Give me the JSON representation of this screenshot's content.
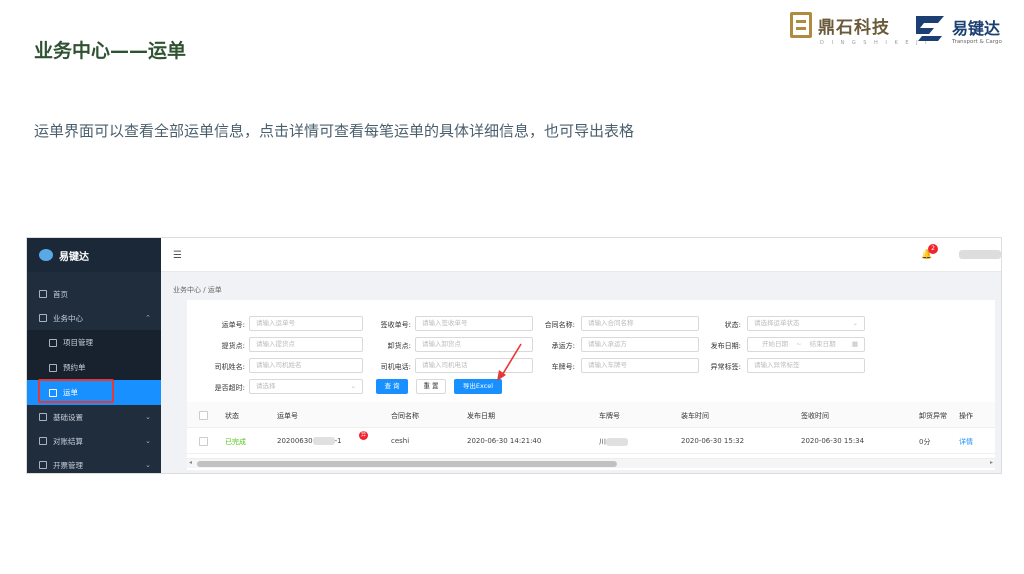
{
  "slide": {
    "title": "业务中心——运单",
    "description": "运单界面可以查看全部运单信息，点击详情可查看每笔运单的具体详细信息，也可导出表格",
    "logo1": {
      "name": "鼎石科技",
      "sub": "D I N G S H I K E J I",
      "color": "#b08a3e"
    },
    "logo2": {
      "name": "易键达",
      "sub": "Transport & Cargo",
      "color": "#1c3f73"
    }
  },
  "app": {
    "brand": "易键达",
    "sidebar": {
      "items": [
        {
          "label": "首页",
          "icon": "home-icon"
        },
        {
          "label": "业务中心",
          "icon": "briefcase-icon",
          "chevron": "⌃"
        },
        {
          "label": "项目管理",
          "icon": "calendar-icon"
        },
        {
          "label": "预约单",
          "icon": "calendar-icon"
        },
        {
          "label": "运单",
          "icon": "document-icon"
        },
        {
          "label": "基础设置",
          "icon": "gear-icon",
          "chevron": "⌄"
        },
        {
          "label": "对账结算",
          "icon": "settlement-icon",
          "chevron": "⌄"
        },
        {
          "label": "开票管理",
          "icon": "invoice-icon",
          "chevron": "⌄"
        }
      ],
      "active_color": "#1890ff"
    },
    "topbar": {
      "notification_count": "2"
    },
    "breadcrumb": "业务中心 / 运单",
    "filters": {
      "waybill_no": {
        "label": "运单号:",
        "placeholder": "请输入运单号"
      },
      "sign_no": {
        "label": "签收单号:",
        "placeholder": "请输入签收单号"
      },
      "contract_name": {
        "label": "合同名称:",
        "placeholder": "请输入合同名称"
      },
      "status": {
        "label": "状态:",
        "placeholder": "请选择运单状态"
      },
      "pickup": {
        "label": "提货点:",
        "placeholder": "请输入提货点"
      },
      "unload": {
        "label": "卸货点:",
        "placeholder": "请输入卸货点"
      },
      "carrier": {
        "label": "承运方:",
        "placeholder": "请输入承运方"
      },
      "publish_date": {
        "label": "发布日期:",
        "start": "开始日期",
        "sep": "~",
        "end": "结束日期"
      },
      "driver_name": {
        "label": "司机姓名:",
        "placeholder": "请输入司机姓名"
      },
      "driver_phone": {
        "label": "司机电话:",
        "placeholder": "请输入司机电话"
      },
      "plate": {
        "label": "车牌号:",
        "placeholder": "请输入车牌号"
      },
      "abnormal": {
        "label": "异常标签:",
        "placeholder": "请输入异常标签"
      },
      "overtime": {
        "label": "是否超时:",
        "placeholder": "请选择"
      }
    },
    "buttons": {
      "search": "查 询",
      "reset": "重 置",
      "export": "导出Excel"
    },
    "table": {
      "columns": [
        "状态",
        "运单号",
        "合同名称",
        "发布日期",
        "车牌号",
        "装车时间",
        "签收时间",
        "卸货异常",
        "操作"
      ],
      "rows": [
        {
          "status": "已完成",
          "waybill_prefix": "20200630",
          "waybill_suffix": "-1",
          "badge": "异",
          "contract": "ceshi",
          "publish_date": "2020-06-30 14:21:40",
          "plate_prefix": "川",
          "load_time": "2020-06-30 15:32",
          "sign_time": "2020-06-30 15:34",
          "abnormal": "0分",
          "action": "详情"
        }
      ]
    },
    "colors": {
      "status_done": "#52c41a",
      "link": "#1890ff",
      "annotation": "#e53935"
    }
  }
}
